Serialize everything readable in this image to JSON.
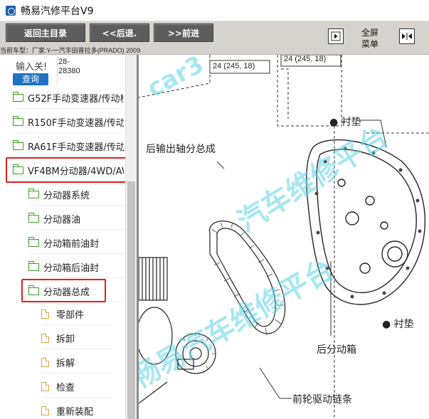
{
  "window": {
    "title": "畅易汽修平台V9"
  },
  "toolbar": {
    "home_label": "返回主目录",
    "back_label": "<<后退.",
    "forward_label": ">>前进",
    "menu_label_line1": "全屏",
    "menu_label_line2": "菜单",
    "car_info": "当前车型：厂家:Y-一汽丰田普拉多(PRADO) 2009"
  },
  "search": {
    "label": "输入关!",
    "button": "查询",
    "value": "28-\n28380"
  },
  "tree": {
    "items": [
      {
        "label": "G52F手动变速器/传动桥"
      },
      {
        "label": "R150F手动变速器/传动桥"
      },
      {
        "label": "RA61F手动变速器/传动桥"
      },
      {
        "label": "VF4BM分动器/4WD/AWD"
      },
      {
        "label": "分动器系统"
      },
      {
        "label": "分动器油"
      },
      {
        "label": "分动箱前油封"
      },
      {
        "label": "分动箱后油封"
      },
      {
        "label": "分动器总成"
      },
      {
        "label": "零部件"
      },
      {
        "label": "拆卸"
      },
      {
        "label": "拆解"
      },
      {
        "label": "检查"
      },
      {
        "label": "重新装配"
      }
    ]
  },
  "diagram": {
    "torque_left": "24 (245, 18)",
    "torque_right": "24 (245, 18)",
    "label_rear_output_shaft": "后输出轴分总成",
    "label_gasket_top": "● 衬垫",
    "label_gasket_right": "● 衬垫",
    "label_rear_case": "后分动箱",
    "label_chain": "前轮驱动链条",
    "watermark_1": "car3",
    "watermark_2": "汽车维修平台",
    "watermark_3": "畅易汽车维修平台"
  },
  "colors": {
    "toolbar_bg": "#d6d3ce",
    "button_bg": "#5d5d5d",
    "search_button": "#1f73c4",
    "folder_icon": "#3a9d1e",
    "doc_icon": "#e0a33a",
    "highlight": "#e02020",
    "watermark": "#5fd4e6"
  }
}
